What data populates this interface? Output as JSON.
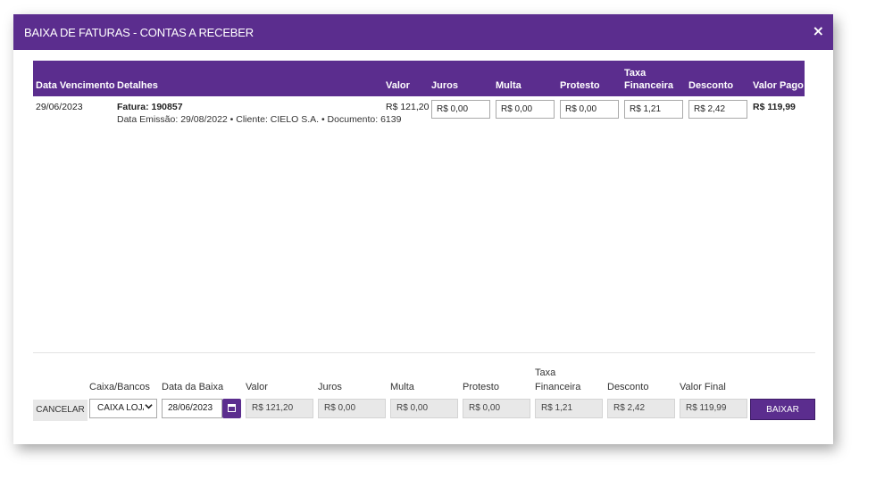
{
  "modal": {
    "title": "BAIXA DE FATURAS - CONTAS A RECEBER",
    "close_symbol": "×"
  },
  "table": {
    "headers": {
      "data_vencimento": "Data Vencimento",
      "detalhes": "Detalhes",
      "valor": "Valor",
      "juros": "Juros",
      "multa": "Multa",
      "protesto": "Protesto",
      "taxa_1": "Taxa",
      "taxa_2": "Financeira",
      "desconto": "Desconto",
      "valor_pago": "Valor Pago"
    },
    "rows": [
      {
        "data_vencimento": "29/06/2023",
        "fatura": "Fatura: 190857",
        "detalhes_linha": "Data Emissão: 29/08/2022 • Cliente: CIELO S.A. • Documento: 6139",
        "valor": "R$ 121,20",
        "juros": "R$ 0,00",
        "multa": "R$ 0,00",
        "protesto": "R$ 0,00",
        "taxa_financeira": "R$ 1,21",
        "desconto": "R$ 2,42",
        "valor_pago": "R$ 119,99"
      }
    ]
  },
  "footer": {
    "labels": {
      "caixa_bancos": "Caixa/Bancos",
      "data_baixa": "Data da Baixa",
      "valor": "Valor",
      "juros": "Juros",
      "multa": "Multa",
      "protesto": "Protesto",
      "taxa_1": "Taxa",
      "taxa_2": "Financeira",
      "desconto": "Desconto",
      "valor_final": "Valor Final"
    },
    "cancel_label": "CANCELAR",
    "caixa_selected": "CAIXA LOJA",
    "data_baixa_value": "28/06/2023",
    "valor": "R$ 121,20",
    "juros": "R$ 0,00",
    "multa": "R$ 0,00",
    "protesto": "R$ 0,00",
    "taxa_financeira": "R$ 1,21",
    "desconto": "R$ 2,42",
    "valor_final": "R$ 119,99",
    "baixar_label": "BAIXAR"
  },
  "colors": {
    "accent": "#5b2d8e"
  },
  "icons": {
    "close": "close-icon",
    "calendar": "calendar-icon",
    "dropdown": "chevron-down-icon"
  }
}
